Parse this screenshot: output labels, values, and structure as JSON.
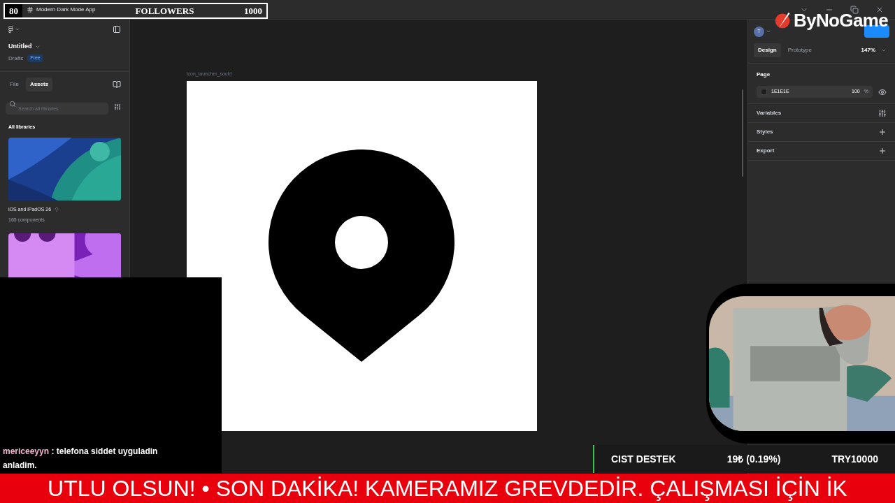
{
  "overlay_counter": {
    "count": "80",
    "label": "FOLLOWERS",
    "goal": "1000"
  },
  "title_bar": {
    "tabs": [
      {
        "label": "Modern Dark Mode App",
        "selected": false
      }
    ]
  },
  "left_panel": {
    "file_name": "Untitled",
    "location": "Drafts",
    "plan_badge": "Free",
    "tabs": [
      {
        "label": "File",
        "selected": false
      },
      {
        "label": "Assets",
        "selected": true
      }
    ],
    "search": {
      "placeholder": "Search all libraries"
    },
    "section_title": "All libraries",
    "libraries": [
      {
        "kind": "picture",
        "name": "iOS and iPadOS 26",
        "count": "165 components"
      },
      {
        "kind": "picture"
      }
    ]
  },
  "canvas": {
    "frame_label": "icon_launcher_sould"
  },
  "right_panel": {
    "avatar": "T",
    "tabs": [
      {
        "label": "Design",
        "selected": true
      },
      {
        "label": "Prototype",
        "selected": false
      }
    ],
    "zoom": "147%",
    "page": {
      "title": "Page",
      "color": "1E1E1E",
      "opacity": "100",
      "unit": "%"
    },
    "sections": [
      {
        "title": "Variables",
        "kind": "settings"
      },
      {
        "title": "Styles",
        "kind": "add"
      },
      {
        "title": "Export",
        "kind": "add"
      }
    ]
  },
  "chat": {
    "user": "mericeeyyn",
    "message": ": telefona siddet uyguladin anladim."
  },
  "donation": {
    "title": "CIST DESTEK",
    "amount": "19₺ (0.19%)",
    "goal": "TRY10000"
  },
  "ticker": {
    "text": "UTLU OLSUN! • SON DAKİKA! KAMERAMIZ GREVDEDİR. ÇALIŞMASI İÇİN İK"
  },
  "logo": {
    "text": "ByNoGame"
  }
}
